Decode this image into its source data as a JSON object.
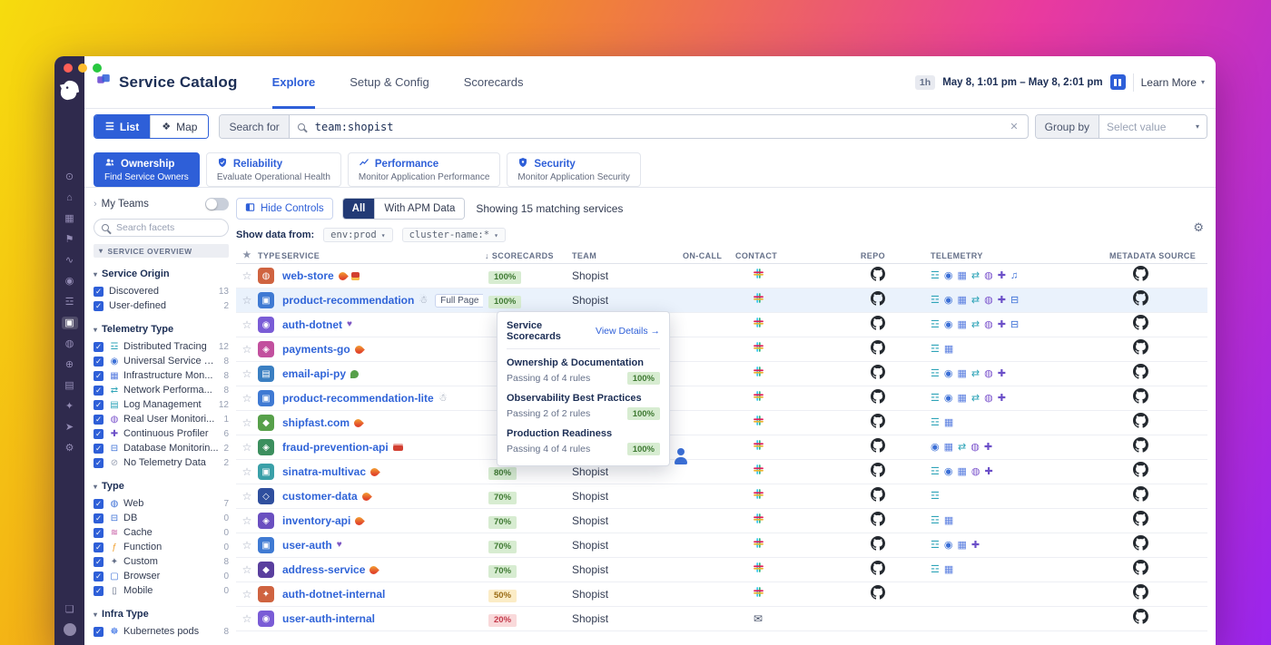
{
  "colors": {
    "accent_blue": "#2e5fd8",
    "link_blue": "#3064d8",
    "nav_purple": "#2f2a4d",
    "title_navy": "#1c2e55",
    "badge_green_bg": "#d7ecd1",
    "badge_green_text": "#3f7a33",
    "badge_yellow_bg": "#fbecc6",
    "badge_yellow_text": "#9a6b15",
    "badge_red_bg": "#f9d9da",
    "badge_red_text": "#c43a4b",
    "row_hover": "#eaf2fc",
    "desktop_gradient": [
      "#f6dc0e",
      "#f2961b",
      "#e93a9e",
      "#9a25ee"
    ]
  },
  "appnav": {
    "icons": [
      {
        "name": "search"
      },
      {
        "name": "infrastructure"
      },
      {
        "name": "dashboards"
      },
      {
        "name": "monitors"
      },
      {
        "name": "metrics"
      },
      {
        "name": "watchdog"
      },
      {
        "name": "apm"
      },
      {
        "name": "service-catalog",
        "active": true
      },
      {
        "name": "ux-monitoring"
      },
      {
        "name": "synthetics"
      },
      {
        "name": "logs"
      },
      {
        "name": "security"
      },
      {
        "name": "ci-cd"
      },
      {
        "name": "settings"
      }
    ],
    "bottom_icons": [
      {
        "name": "chat"
      },
      {
        "name": "user"
      }
    ]
  },
  "header": {
    "title": "Service Catalog",
    "tabs": [
      {
        "label": "Explore",
        "active": true
      },
      {
        "label": "Setup & Config",
        "active": false
      },
      {
        "label": "Scorecards",
        "active": false
      }
    ],
    "time_range_badge": "1h",
    "time_range": "May 8, 1:01 pm – May 8, 2:01 pm",
    "learn_more_label": "Learn More"
  },
  "toolbar": {
    "view_toggle": [
      {
        "label": "List",
        "icon": "list",
        "active": true
      },
      {
        "label": "Map",
        "icon": "map",
        "active": false
      }
    ],
    "search_for_label": "Search for",
    "search_query": "team:shopist",
    "group_by_label": "Group by",
    "group_by_placeholder": "Select value"
  },
  "filter_cards": [
    {
      "title": "Ownership",
      "subtitle": "Find Service Owners",
      "icon": "owners",
      "active": true
    },
    {
      "title": "Reliability",
      "subtitle": "Evaluate Operational Health",
      "icon": "reliability",
      "active": false
    },
    {
      "title": "Performance",
      "subtitle": "Monitor Application Performance",
      "icon": "performance",
      "active": false
    },
    {
      "title": "Security",
      "subtitle": "Monitor Application Security",
      "icon": "security",
      "active": false
    }
  ],
  "facets": {
    "my_teams_label": "My Teams",
    "search_placeholder": "Search facets",
    "overview_label": "SERVICE OVERVIEW",
    "groups": [
      {
        "title": "Service Origin",
        "items": [
          {
            "label": "Discovered",
            "count": 13,
            "checked": true
          },
          {
            "label": "User-defined",
            "count": 2,
            "checked": true
          }
        ]
      },
      {
        "title": "Telemetry Type",
        "items": [
          {
            "label": "Distributed Tracing",
            "count": 12,
            "checked": true,
            "icon": "tracing"
          },
          {
            "label": "Universal Service M...",
            "count": 8,
            "checked": true,
            "icon": "usm"
          },
          {
            "label": "Infrastructure Mon...",
            "count": 8,
            "checked": true,
            "icon": "infra"
          },
          {
            "label": "Network Performa...",
            "count": 8,
            "checked": true,
            "icon": "network"
          },
          {
            "label": "Log Management",
            "count": 12,
            "checked": true,
            "icon": "logs"
          },
          {
            "label": "Real User Monitori...",
            "count": 1,
            "checked": true,
            "icon": "rum"
          },
          {
            "label": "Continuous Profiler",
            "count": 6,
            "checked": true,
            "icon": "profiling"
          },
          {
            "label": "Database Monitorin...",
            "count": 2,
            "checked": true,
            "icon": "database"
          },
          {
            "label": "No Telemetry Data",
            "count": 2,
            "checked": true,
            "icon": "none"
          }
        ]
      },
      {
        "title": "Type",
        "items": [
          {
            "label": "Web",
            "count": 7,
            "checked": true,
            "icon": "web"
          },
          {
            "label": "DB",
            "count": 0,
            "checked": true,
            "icon": "db"
          },
          {
            "label": "Cache",
            "count": 0,
            "checked": true,
            "icon": "cache"
          },
          {
            "label": "Function",
            "count": 0,
            "checked": true,
            "icon": "function"
          },
          {
            "label": "Custom",
            "count": 8,
            "checked": true,
            "icon": "custom"
          },
          {
            "label": "Browser",
            "count": 0,
            "checked": true,
            "icon": "browser"
          },
          {
            "label": "Mobile",
            "count": 0,
            "checked": true,
            "icon": "mobile"
          }
        ]
      },
      {
        "title": "Infra Type",
        "items": [
          {
            "label": "Kubernetes pods",
            "count": 8,
            "checked": true,
            "icon": "kubernetes"
          }
        ]
      }
    ]
  },
  "controls": {
    "hide_controls_label": "Hide Controls",
    "segments": [
      {
        "label": "All",
        "active": true
      },
      {
        "label": "With APM Data",
        "active": false
      }
    ],
    "results_text": "Showing 15 matching services",
    "show_data_from_label": "Show data from:",
    "data_filters": [
      "env:prod",
      "cluster-name:*"
    ]
  },
  "table": {
    "headers": {
      "type": "TYPE",
      "service": "SERVICE",
      "scorecards": "SCORECARDS",
      "team": "TEAM",
      "oncall": "ON-CALL",
      "contact": "CONTACT",
      "repo": "REPO",
      "telemetry": "TELEMETRY",
      "metadata": "METADATA SOURCE"
    },
    "sort_column": "scorecards",
    "rows": [
      {
        "service": "web-store",
        "emojis": [
          "fire",
          "alarm"
        ],
        "type": {
          "color": "#cf6340",
          "glyph": "◍"
        },
        "scorecard": "100%",
        "score_level": "good",
        "team": "Shopist",
        "oncall": "#7a5c49",
        "contact": "slack",
        "repo": true,
        "telemetry": [
          "tracing",
          "usm",
          "infra",
          "network",
          "rum",
          "profiling",
          "processes"
        ],
        "metadata": "github"
      },
      {
        "service": "product-recommendation",
        "emojis": [
          "snowman"
        ],
        "hovered": true,
        "full_page_label": "Full Page",
        "type": {
          "color": "#3f7ad3",
          "glyph": "▣"
        },
        "scorecard": "100%",
        "score_level": "good",
        "team": "Shopist",
        "oncall": "#4a3b33",
        "contact": "slack",
        "repo": true,
        "telemetry": [
          "tracing",
          "usm",
          "infra",
          "network",
          "rum",
          "profiling",
          "database"
        ],
        "metadata": "github"
      },
      {
        "service": "auth-dotnet",
        "emojis": [
          "purple-heart"
        ],
        "type": {
          "color": "#7a5cd6",
          "glyph": "◉"
        },
        "scorecard": null,
        "team": null,
        "oncall": "#3f5a3f",
        "contact": "slack",
        "repo": true,
        "telemetry": [
          "tracing",
          "usm",
          "infra",
          "network",
          "rum",
          "profiling",
          "database"
        ],
        "metadata": "github"
      },
      {
        "service": "payments-go",
        "emojis": [
          "fire"
        ],
        "type": {
          "color": "#c2509e",
          "glyph": "◈"
        },
        "scorecard": null,
        "team": null,
        "oncall": "#5b4a3a",
        "contact": "slack",
        "repo": true,
        "telemetry": [
          "tracing",
          "infra"
        ],
        "metadata": "github"
      },
      {
        "service": "email-api-py",
        "emojis": [
          "plant"
        ],
        "type": {
          "color": "#3a7fc2",
          "glyph": "▤"
        },
        "scorecard": null,
        "team": null,
        "oncall": "#c79b7b",
        "contact": "slack",
        "repo": true,
        "telemetry": [
          "tracing",
          "usm",
          "infra",
          "network",
          "rum",
          "profiling"
        ],
        "metadata": "github"
      },
      {
        "service": "product-recommendation-lite",
        "emojis": [
          "snowman"
        ],
        "type": {
          "color": "#3f7ad3",
          "glyph": "▣"
        },
        "scorecard": null,
        "team": null,
        "oncall": "#8a7a6a",
        "contact": "slack",
        "repo": true,
        "telemetry": [
          "tracing",
          "usm",
          "infra",
          "network",
          "rum",
          "profiling"
        ],
        "metadata": "github"
      },
      {
        "service": "shipfast.com",
        "emojis": [
          "fire"
        ],
        "type": {
          "color": "#57a04a",
          "glyph": "◆"
        },
        "scorecard": null,
        "team": null,
        "oncall": "#6b5544",
        "contact": "slack",
        "repo": true,
        "telemetry": [
          "tracing",
          "infra"
        ],
        "metadata": "github"
      },
      {
        "service": "fraud-prevention-api",
        "emojis": [
          "firetruck"
        ],
        "type": {
          "color": "#3c8f5e",
          "glyph": "◈"
        },
        "scorecard": null,
        "team": null,
        "oncall": "default",
        "contact": "slack",
        "repo": true,
        "telemetry": [
          "usm",
          "infra",
          "network",
          "rum",
          "profiling"
        ],
        "metadata": "github"
      },
      {
        "service": "sinatra-multivac",
        "emojis": [
          "fire"
        ],
        "type": {
          "color": "#3aa0a8",
          "glyph": "▣"
        },
        "scorecard": "80%",
        "score_level": "good",
        "team": "Shopist",
        "oncall": "#6e5a4a",
        "contact": "slack",
        "repo": true,
        "telemetry": [
          "tracing",
          "usm",
          "infra",
          "rum",
          "profiling"
        ],
        "metadata": "github"
      },
      {
        "service": "customer-data",
        "emojis": [
          "fire"
        ],
        "type": {
          "color": "#2f4f9e",
          "glyph": "◇"
        },
        "scorecard": "70%",
        "score_level": "good",
        "team": "Shopist",
        "oncall": "#3a2f2a",
        "contact": "slack",
        "repo": true,
        "telemetry": [
          "tracing"
        ],
        "metadata": "github"
      },
      {
        "service": "inventory-api",
        "emojis": [
          "fire"
        ],
        "type": {
          "color": "#6a4fc0",
          "glyph": "◈"
        },
        "scorecard": "70%",
        "score_level": "good",
        "team": "Shopist",
        "oncall": "#c7a58b",
        "contact": "slack",
        "repo": true,
        "telemetry": [
          "tracing",
          "infra"
        ],
        "metadata": "github"
      },
      {
        "service": "user-auth",
        "emojis": [
          "purple-heart"
        ],
        "type": {
          "color": "#3f7ad3",
          "glyph": "▣"
        },
        "scorecard": "70%",
        "score_level": "good",
        "team": "Shopist",
        "oncall": "#2f2a26",
        "contact": "slack",
        "repo": true,
        "telemetry": [
          "tracing",
          "usm",
          "infra",
          "profiling"
        ],
        "metadata": "github"
      },
      {
        "service": "address-service",
        "emojis": [
          "fire"
        ],
        "type": {
          "color": "#5a3f9e",
          "glyph": "◆"
        },
        "scorecard": "70%",
        "score_level": "good",
        "team": "Shopist",
        "oncall": "#3a332e",
        "contact": "slack",
        "repo": true,
        "telemetry": [
          "tracing",
          "infra"
        ],
        "metadata": "github"
      },
      {
        "service": "auth-dotnet-internal",
        "emojis": [],
        "type": {
          "color": "#cf6340",
          "glyph": "✦"
        },
        "scorecard": "50%",
        "score_level": "warn",
        "team": "Shopist",
        "oncall": "#c79b7b",
        "contact": "slack",
        "repo": true,
        "telemetry": [],
        "metadata": "github"
      },
      {
        "service": "user-auth-internal",
        "emojis": [],
        "type": {
          "color": "#7a5cd6",
          "glyph": "◉"
        },
        "scorecard": "20%",
        "score_level": "bad",
        "team": "Shopist",
        "oncall": null,
        "contact": "email",
        "repo": false,
        "telemetry": [],
        "metadata": "github"
      }
    ]
  },
  "popover": {
    "title": "Service Scorecards",
    "link_label": "View Details →",
    "sections": [
      {
        "name": "Ownership & Documentation",
        "detail": "Passing 4 of 4 rules",
        "score": "100%"
      },
      {
        "name": "Observability Best Practices",
        "detail": "Passing 2 of 2 rules",
        "score": "100%"
      },
      {
        "name": "Production Readiness",
        "detail": "Passing 4 of 4 rules",
        "score": "100%"
      }
    ]
  },
  "icon_colors": {
    "tracing": "#2fa4b8",
    "usm": "#3b6fd6",
    "infra": "#5b7fe0",
    "network": "#2fa4b8",
    "rum": "#7a52cc",
    "profiling": "#6b4fc8",
    "processes": "#3b6fd6",
    "database": "#3b6fd6",
    "logs": "#2fa4b8",
    "none": "#98a0b3",
    "web": "#3b6fd6",
    "db": "#3b6fd6",
    "cache": "#c2509e",
    "function": "#f0a030",
    "custom": "#657089",
    "browser": "#3b6fd6",
    "mobile": "#657089",
    "kubernetes": "#326ce5"
  }
}
